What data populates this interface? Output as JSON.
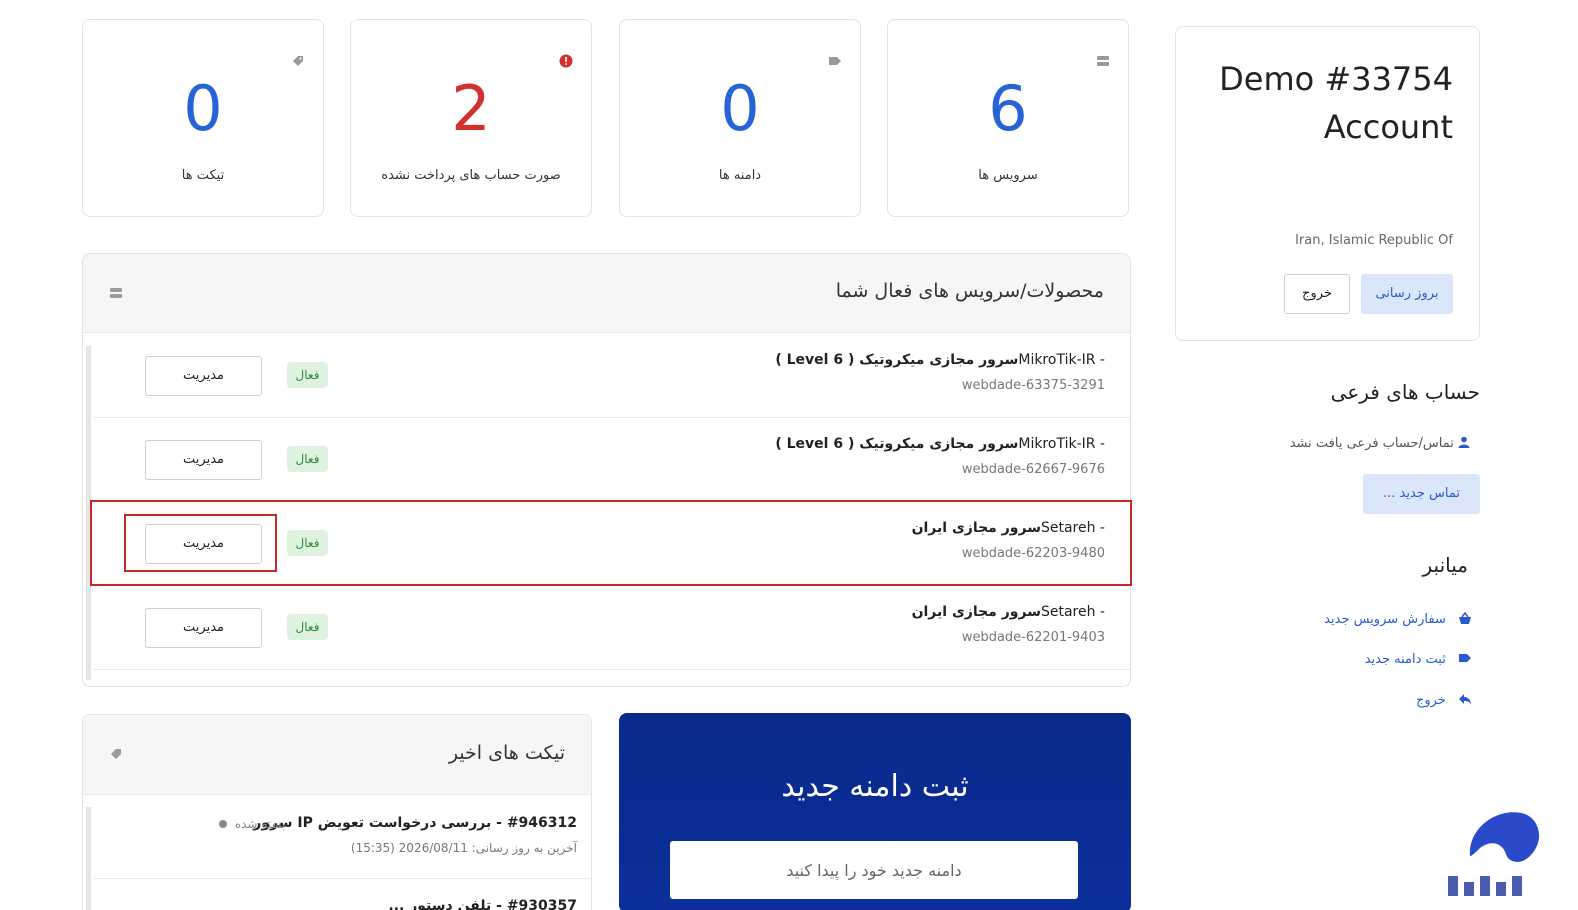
{
  "stats": [
    {
      "value": "6",
      "label": "سرویس ها",
      "color": "#2563d6",
      "icon": "server-icon"
    },
    {
      "value": "0",
      "label": "دامنه ها",
      "color": "#2563d6",
      "icon": "tag-icon"
    },
    {
      "value": "2",
      "label": "صورت حساب های پرداخت نشده",
      "color": "#d32f2f",
      "icon": "alert-icon"
    },
    {
      "value": "0",
      "label": "تیکت ها",
      "color": "#2563d6",
      "icon": "ticket-tag-icon"
    }
  ],
  "services": {
    "title": "محصولات/سرویس های فعال شما",
    "rows": [
      {
        "name_bold": "سرور مجازی میکروتیک ( Level 6 )",
        "name_suffix": " - MikroTik-IR",
        "id": "webdade-63375-3291",
        "status": "فعال",
        "action": "مدیریت"
      },
      {
        "name_bold": "سرور مجازی میکروتیک ( Level 6 )",
        "name_suffix": " - MikroTik-IR",
        "id": "webdade-62667-9676",
        "status": "فعال",
        "action": "مدیریت"
      },
      {
        "name_bold": "سرور مجازی ایران",
        "name_suffix": " - Setareh",
        "id": "webdade-62203-9480",
        "status": "فعال",
        "action": "مدیریت"
      },
      {
        "name_bold": "سرور مجازی ایران",
        "name_suffix": " - Setareh",
        "id": "webdade-62201-9403",
        "status": "فعال",
        "action": "مدیریت"
      }
    ]
  },
  "tickets": {
    "title": "تیکت های اخیر",
    "rows": [
      {
        "subject": "#946312 - بررسی درخواست تعویض IP سرور",
        "status": "بسته شده",
        "updated": "آخرین به روز رسانی: 2026/08/11 (15:35)"
      },
      {
        "subject": "#930357 - تلفن دستور ...",
        "status": "...",
        "updated": ""
      }
    ]
  },
  "domain_search": {
    "title": "ثبت دامنه جدید",
    "placeholder": "دامنه جدید خود را پیدا کنید"
  },
  "account": {
    "title": "Demo #33754 Account",
    "country": "Iran, Islamic Republic Of",
    "update_label": "بروز رسانی",
    "logout_label": "خروج"
  },
  "subaccounts": {
    "title": "حساب های فرعی",
    "empty_text": "تماس/حساب فرعی یافت نشد",
    "new_contact_label": "تماس جدید ..."
  },
  "shortcuts": {
    "title": "میانبر",
    "items": [
      {
        "label": "سفارش سرویس جدید",
        "icon": "basket-icon"
      },
      {
        "label": "ثبت دامنه جدید",
        "icon": "tag-icon"
      },
      {
        "label": "خروج",
        "icon": "reply-arrow-icon"
      }
    ]
  },
  "colors": {
    "accent": "#2a5ad0",
    "danger": "#d32f2f",
    "success": "#2e8b3a",
    "domain_bg": "#0b2f9a"
  }
}
